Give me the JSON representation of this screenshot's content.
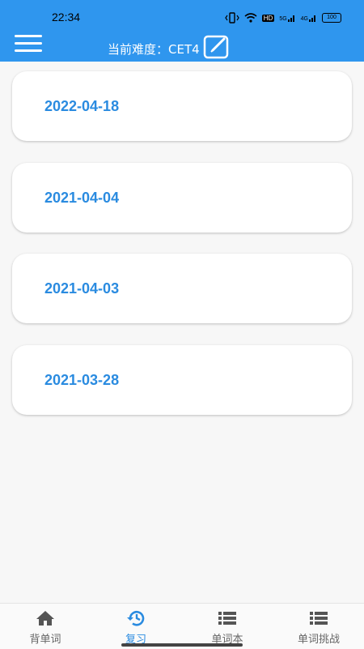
{
  "status": {
    "time": "22:34",
    "battery": "100",
    "network_badge": "HD",
    "signal_1": "5G",
    "signal_2": "4G"
  },
  "header": {
    "difficulty_label": "当前难度：CET4",
    "menu_icon": "hamburger-menu-icon",
    "edit_icon": "edit-icon"
  },
  "records": [
    {
      "date": "2022-04-18"
    },
    {
      "date": "2021-04-04"
    },
    {
      "date": "2021-04-03"
    },
    {
      "date": "2021-03-28"
    }
  ],
  "nav": [
    {
      "label": "背单词",
      "icon": "home-icon",
      "active": false
    },
    {
      "label": "复习",
      "icon": "history-icon",
      "active": true
    },
    {
      "label": "单词本",
      "icon": "list-icon",
      "active": false
    },
    {
      "label": "单词挑战",
      "icon": "list-icon",
      "active": false
    }
  ],
  "colors": {
    "primary": "#2f96ee",
    "accent_text": "#2a8be0",
    "background": "#f7f7f7"
  }
}
